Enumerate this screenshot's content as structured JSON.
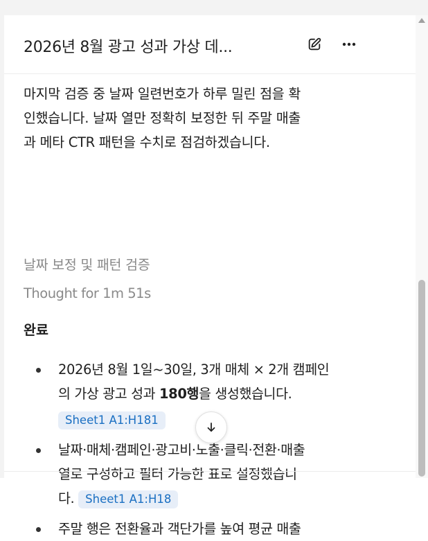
{
  "header": {
    "title": "2026년 8월 광고 성과 가상 데...",
    "edit_icon": "edit-pencil-icon",
    "more_icon": "more-horizontal-icon"
  },
  "message": {
    "paragraph_line1": "마지막 검증 중 날짜 일련번호가 하루 밀린 점을 확",
    "paragraph_line2": "인했습니다. 날짜 열만 정확히 보정한 뒤 주말 매출",
    "paragraph_line3": "과 메타 CTR 패턴을 수치로 점검하겠습니다.",
    "step_label": "날짜 보정 및 패턴 검증",
    "thought_label": "Thought for 1m 51s",
    "done_heading": "완료",
    "bullets": [
      {
        "pre": "2026년 8월 1일~30일, 3개 매체 × 2개 캠페인",
        "line2_pre": "의 가상 광고 성과 ",
        "bold": "180행",
        "line2_post": "을 생성했습니다.",
        "chip_sheet": "Sheet1",
        "chip_range": "A1:H181"
      },
      {
        "line1": "날짜·매체·캠페인·광고비·노출·클릭·전환·매출",
        "line2": "열로 구성하고 필터 가능한 표로 설정했습니",
        "line3": "다.",
        "chip_sheet": "Sheet1",
        "chip_range": "A1:H18"
      },
      {
        "line1": "주말 행은 전환율과 객단가를 높여 평균 매출"
      }
    ]
  },
  "scroll_button_icon": "arrow-down-icon"
}
